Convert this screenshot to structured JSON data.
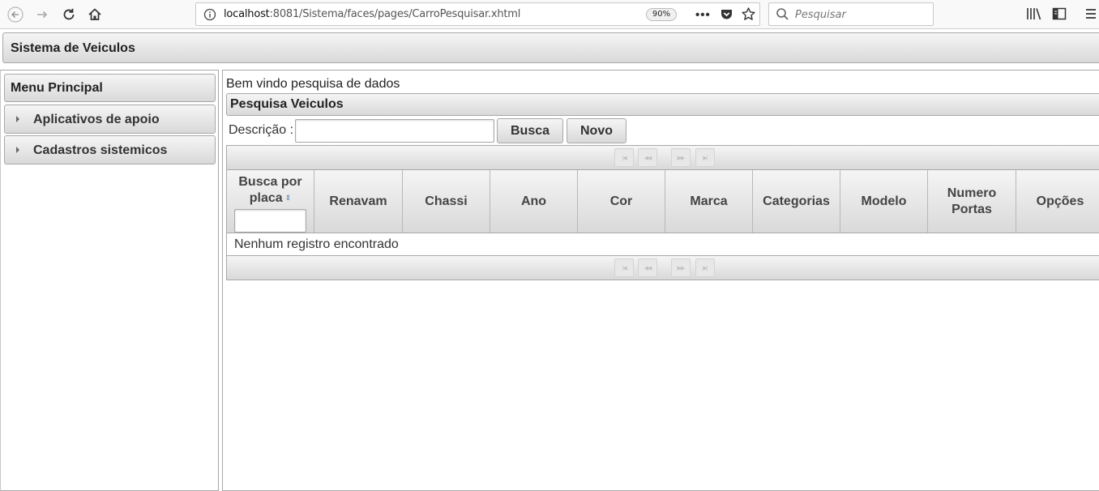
{
  "browser": {
    "url_host": "localhost",
    "url_rest": ":8081/Sistema/faces/pages/CarroPesquisar.xhtml",
    "zoom": "90%",
    "search_placeholder": "Pesquisar"
  },
  "header": {
    "title": "Sistema de Veiculos"
  },
  "sidebar": {
    "title": "Menu Principal",
    "items": [
      {
        "label": "Aplicativos de apoio"
      },
      {
        "label": "Cadastros sistemicos"
      }
    ]
  },
  "main": {
    "welcome": "Bem vindo pesquisa de dados",
    "panel_title": "Pesquisa Veiculos",
    "description_label": "Descrição :",
    "description_value": "",
    "search_button": "Busca",
    "new_button": "Novo",
    "paginator": {
      "first": "|◀",
      "prev": "◀◀",
      "next": "▶▶",
      "last": "▶|"
    },
    "table": {
      "sort_col_label": "Busca por placa",
      "sort_icon": "⇕",
      "columns": [
        "Renavam",
        "Chassi",
        "Ano",
        "Cor",
        "Marca",
        "Categorias",
        "Modelo",
        "Numero Portas",
        "Opções"
      ],
      "empty_message": "Nenhum registro encontrado"
    }
  }
}
